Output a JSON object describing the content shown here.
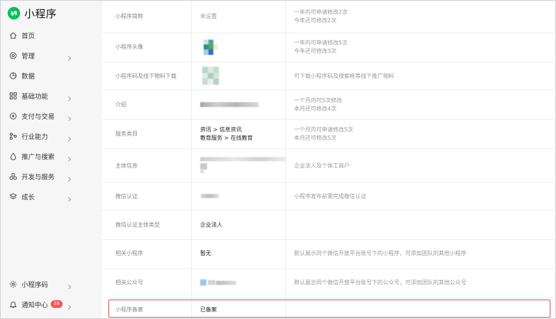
{
  "app": {
    "title": "小程序"
  },
  "sidebar": {
    "items": [
      {
        "label": "首页",
        "icon": "home-icon",
        "chevron": false
      },
      {
        "label": "管理",
        "icon": "settings-icon",
        "chevron": true
      },
      {
        "label": "数据",
        "icon": "chart-icon",
        "chevron": false
      },
      {
        "label": "基础功能",
        "icon": "grid-icon",
        "chevron": true
      },
      {
        "label": "支付与交易",
        "icon": "payment-icon",
        "chevron": true
      },
      {
        "label": "行业能力",
        "icon": "industry-icon",
        "chevron": true
      },
      {
        "label": "推广与搜索",
        "icon": "promote-icon",
        "chevron": true
      },
      {
        "label": "开发与服务",
        "icon": "dev-icon",
        "chevron": true
      },
      {
        "label": "成长",
        "icon": "growth-icon",
        "chevron": true
      }
    ],
    "bottom": [
      {
        "label": "小程序码",
        "icon": "qrcode-icon"
      },
      {
        "label": "通知中心",
        "icon": "bell-icon",
        "badge": "38"
      }
    ]
  },
  "rows": [
    {
      "label": "小程序简称",
      "value": "未设置",
      "desc1": "一年内可申请修改2次",
      "desc2": "今年还可修改2次"
    },
    {
      "label": "小程序头像",
      "value": "",
      "desc1": "一年内可申请修改5次",
      "desc2": "今年还可修改3次"
    },
    {
      "label": "小程序码及线下物料下载",
      "value": "",
      "desc1": "可下载小程序码及搜索框等线下推广物料",
      "desc2": ""
    },
    {
      "label": "介绍",
      "value": "",
      "desc1": "一个月内可5次修改",
      "desc2": "本月还可修改4次"
    },
    {
      "label": "服务类目",
      "value": "资讯 > 信息资讯",
      "value2": "教育服务 > 在线教育",
      "desc1": "一个月内可申请修改5次",
      "desc2": "本月还可修改5次"
    },
    {
      "label": "主体信息",
      "value": "",
      "desc1": "企业法人及个体工商户",
      "desc2": ""
    },
    {
      "label": "微信认证",
      "value": "",
      "desc1": "小程序发布前需完成微信认证",
      "desc2": ""
    },
    {
      "label": "微信认证主体类型",
      "value": "企业法人",
      "desc1": "",
      "desc2": ""
    },
    {
      "label": "相关小程序",
      "value": "暂无",
      "desc1": "默认展示同个微信开放平台账号下的小程序，可添加团队的其他小程序",
      "desc2": ""
    },
    {
      "label": "相关公众号",
      "value": "",
      "desc1": "默认展示同个微信开放平台账号下的公众号，可添加团队的其他公众号",
      "desc2": ""
    },
    {
      "label": "小程序备案",
      "value": "已备案",
      "desc1": "",
      "desc2": ""
    }
  ],
  "colors": {
    "brand": "#07c160",
    "badge": "#fa5151",
    "highlight": "#d9534f"
  }
}
